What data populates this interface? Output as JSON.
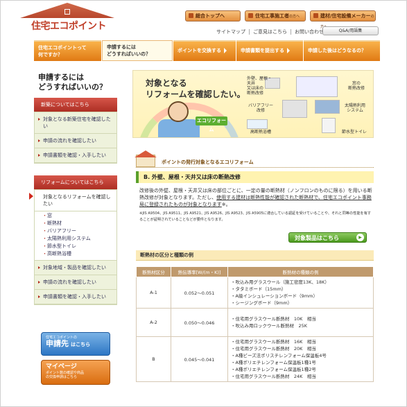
{
  "header": {
    "logo": "住宅エコポイント",
    "top_buttons": [
      {
        "label": "総合トップへ",
        "suffix": ""
      },
      {
        "label": "住宅工事施工者",
        "suffix": "の方へ"
      },
      {
        "label": "建材/住宅設備メーカー",
        "suffix": "の方へ"
      }
    ],
    "links": [
      "サイトマップ",
      "ご意見はこちら",
      "お問い合わせ先"
    ],
    "qa_button": "Q&A/用語集"
  },
  "tabs": [
    {
      "label": "住宅エコポイントって\n何ですか？",
      "active": false
    },
    {
      "label": "申請するには\nどうすればいいの？",
      "active": true
    },
    {
      "label": "ポイントを交換する",
      "active": false
    },
    {
      "label": "申請書類を提出する",
      "active": false
    },
    {
      "label": "申請した後はどうなるの？",
      "active": false
    }
  ],
  "sidebar": {
    "title": "申請するには\nどうすればいいの？",
    "new_build": {
      "head": "新築についてはこちら",
      "items": [
        "対象となる新築住宅を確認したい",
        "申請の流れを確認したい",
        "申請書類を確認・入手したい"
      ]
    },
    "reform": {
      "head": "リフォームについてはこちら",
      "current": "対象となるリフォームを確認したい",
      "subs": [
        "窓",
        "断熱材",
        "バリアフリー",
        "太陽熱利用システム",
        "節水型トイレ",
        "高断熱浴槽"
      ],
      "items": [
        "対象地域・製品を確認したい",
        "申請の流れを確認したい",
        "申請書類を確認・入手したい"
      ]
    },
    "apply_btn": {
      "line1": "住宅エコポイントの",
      "line2": "申請先",
      "line3": "はこちら"
    },
    "mypage_btn": {
      "line1": "マイページ",
      "line2": "ポイント数の確認や商品",
      "line3": "の交換申請はこちら"
    }
  },
  "banner": {
    "title": "対象となる\nリフォームを確認したい。",
    "badge": "エコリフォーム",
    "cells": [
      "外壁、屋根・天井\n又は床の\n断熱改修",
      "窓の\n断熱改修",
      "バリアフリー\n改修",
      "太陽熱利用\nシステム",
      "高断熱浴槽",
      "節水型トイレ"
    ]
  },
  "section": {
    "breadcrumb": "ポイントの発行対象となるエコリフォーム",
    "heading": "B. 外壁、屋根・天井又は床の断熱改修",
    "body_plain": "改修後の外壁、屋根・天井又は床の部位ごとに、一定の量の断熱材（ノンフロンのものに限る）を用いる断熱改修が対象となります。ただし、",
    "body_underlined": "使用する建材は断熱性能が確認された断熱材で、住宅エコポイント事務局に登録されたものが対象となります",
    "body_tail": "※。",
    "note": "※JIS A9504、JIS A9511、JIS A9521、JIS A9526、JIS A9523、JIS A5905に適合している認証を受けていることや、それと同等の性能を有することが証明されていることなどが要件となります。",
    "target_button": "対象製品はこちら"
  },
  "table": {
    "title": "断熱材の区分と種類の例",
    "headers": [
      "断熱材区分",
      "熱伝導率[W/(m・K)]",
      "断熱材の種類の例"
    ],
    "rows": [
      {
        "class": "A-1",
        "conductivity": "0.052〜0.051",
        "examples": [
          "・吹込み用グラスウール（施工密度13K、18K）",
          "・タタミボード（15mm）",
          "・A級インシュレーションボード（9mm）",
          "・シージングボード（9mm）"
        ]
      },
      {
        "class": "A-2",
        "conductivity": "0.050〜0.046",
        "examples": [
          "・住宅用グラスウール断熱材　10K　相当",
          "・吹込み用ロックウール断熱材　25K"
        ]
      },
      {
        "class": "B",
        "conductivity": "0.045〜0.041",
        "examples": [
          "・住宅用グラスウール断熱材　16K　相当",
          "・住宅用グラスウール断熱材　20K　相当",
          "・A種ビーズ法ポリスチレンフォーム保温板4号",
          "・A種ポリエチレンフォーム保温板1種1号",
          "・A種ポリエチレンフォーム保温板1種2号",
          "・住宅用グラスウール断熱材　24K　相当"
        ]
      }
    ]
  },
  "colors": {
    "brand_red": "#c0402a",
    "tab_orange": "#e07a14",
    "sidebar_red": "#ad2e23",
    "sidebar_bg": "#eef2dc",
    "accent_green": "#5aa02c",
    "table_header": "#c09a6d"
  }
}
